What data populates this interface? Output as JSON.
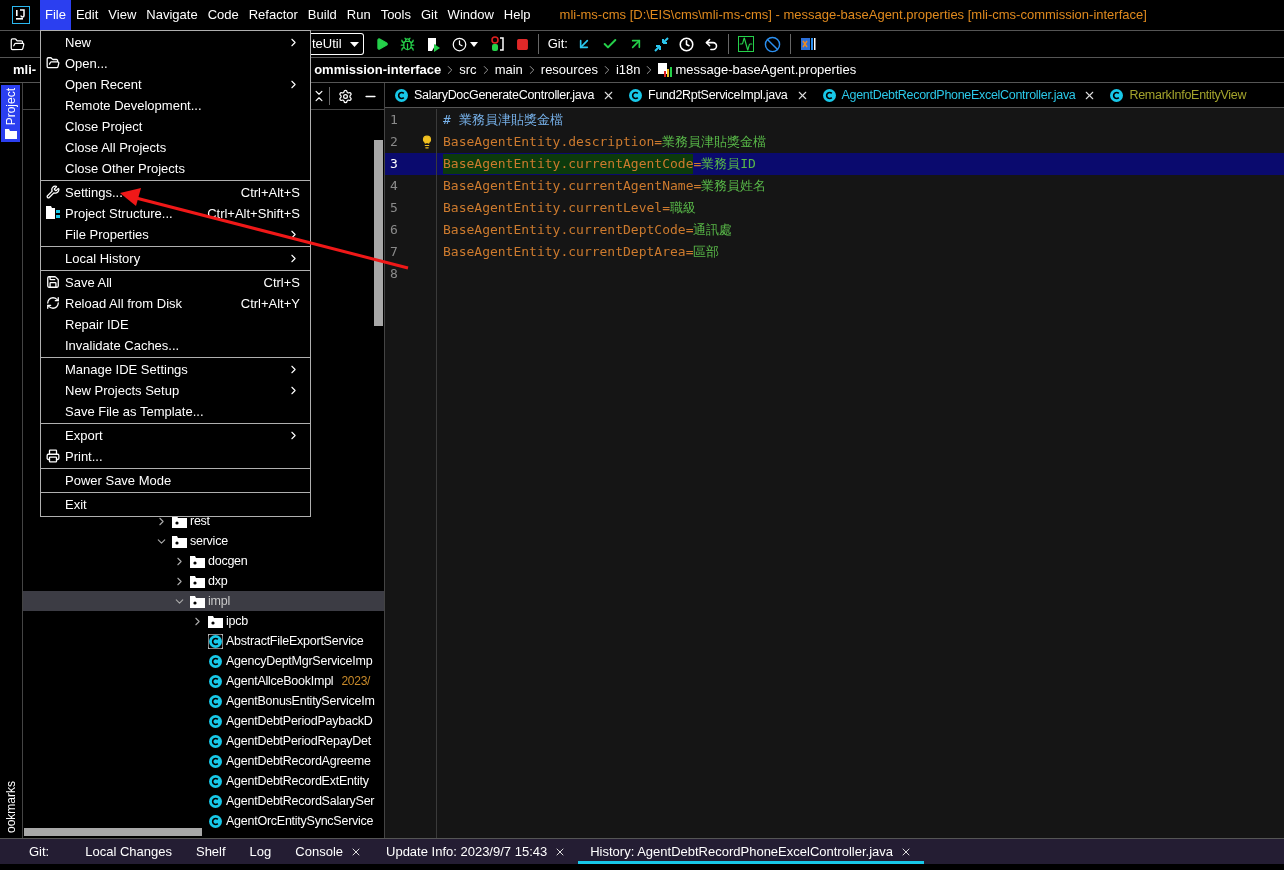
{
  "title_bar": {
    "menus": [
      {
        "label": "File",
        "selected": true
      },
      {
        "label": "Edit",
        "selected": false
      },
      {
        "label": "View",
        "selected": false
      },
      {
        "label": "Navigate",
        "selected": false
      },
      {
        "label": "Code",
        "selected": false
      },
      {
        "label": "Refactor",
        "selected": false
      },
      {
        "label": "Build",
        "selected": false
      },
      {
        "label": "Run",
        "selected": false
      },
      {
        "label": "Tools",
        "selected": false
      },
      {
        "label": "Git",
        "selected": false
      },
      {
        "label": "Window",
        "selected": false
      },
      {
        "label": "Help",
        "selected": false
      }
    ],
    "title": "mli-ms-cms [D:\\EIS\\cms\\mli-ms-cms] - message-baseAgent.properties [mli-cms-commission-interface]"
  },
  "toolbar": {
    "run_config": "teUtil",
    "git_label": "Git:"
  },
  "breadcrumb": {
    "project": "mli-",
    "items": [
      {
        "label": "ommission-interface",
        "kind": "module"
      },
      {
        "label": "src",
        "kind": "folder"
      },
      {
        "label": "main",
        "kind": "folder"
      },
      {
        "label": "resources",
        "kind": "folder"
      },
      {
        "label": "i18n",
        "kind": "folder"
      },
      {
        "label": "message-baseAgent.properties",
        "kind": "file"
      }
    ]
  },
  "side_tabs": [
    {
      "label": "Project",
      "selected": true
    },
    {
      "label": "ookmarks",
      "selected": false
    }
  ],
  "project_tree": [
    {
      "label": "rest",
      "kind": "folder",
      "expanded": false,
      "selected": false
    },
    {
      "label": "service",
      "kind": "folder",
      "expanded": true,
      "selected": false,
      "children": [
        {
          "label": "docgen",
          "kind": "folder",
          "expanded": false,
          "selected": false
        },
        {
          "label": "dxp",
          "kind": "folder",
          "expanded": false,
          "selected": false
        },
        {
          "label": "impl",
          "kind": "folder",
          "expanded": true,
          "selected": true,
          "children": [
            {
              "label": "ipcb",
              "kind": "folder",
              "expanded": false,
              "selected": false
            },
            {
              "label": "AbstractFileExportService",
              "kind": "abstract",
              "selected": false
            },
            {
              "label": "AgencyDeptMgrServiceImp",
              "kind": "class",
              "selected": false
            },
            {
              "label": "AgentAllceBookImpl",
              "kind": "class",
              "selected": false,
              "note": "2023/"
            },
            {
              "label": "AgentBonusEntityServiceIm",
              "kind": "class",
              "selected": false
            },
            {
              "label": "AgentDebtPeriodPaybackD",
              "kind": "class",
              "selected": false
            },
            {
              "label": "AgentDebtPeriodRepayDet",
              "kind": "class",
              "selected": false
            },
            {
              "label": "AgentDebtRecordAgreeme",
              "kind": "class",
              "selected": false
            },
            {
              "label": "AgentDebtRecordExtEntity",
              "kind": "class",
              "selected": false
            },
            {
              "label": "AgentDebtRecordSalarySer",
              "kind": "class",
              "selected": false
            },
            {
              "label": "AgentOrcEntitySyncService",
              "kind": "class",
              "selected": false
            }
          ]
        }
      ]
    }
  ],
  "editor": {
    "tabs": [
      {
        "label": "SalaryDocGenerateController.java",
        "color": "#ffffff",
        "closable": true
      },
      {
        "label": "Fund2RptServiceImpl.java",
        "color": "#ffffff",
        "closable": true
      },
      {
        "label": "AgentDebtRecordPhoneExcelController.java",
        "color": "#2bc8e8",
        "closable": true
      },
      {
        "label": "RemarkInfoEntityView",
        "color": "#a3a32c",
        "closable": false
      }
    ],
    "lines": [
      {
        "number": "1",
        "kind": "comment",
        "text": "# 業務員津貼獎金檔",
        "current": false
      },
      {
        "number": "2",
        "kind": "property",
        "key": "BaseAgentEntity.description",
        "separator": "=",
        "value": "業務員津貼獎金檔",
        "current": false,
        "highlighted": false,
        "bulb": true
      },
      {
        "number": "3",
        "kind": "property",
        "key": "BaseAgentEntity.currentAgentCode",
        "separator": "=",
        "value": "業務員ID",
        "current": true,
        "highlighted": true,
        "bulb": false
      },
      {
        "number": "4",
        "kind": "property",
        "key": "BaseAgentEntity.currentAgentName",
        "separator": "=",
        "value": "業務員姓名",
        "current": false,
        "highlighted": false,
        "bulb": false
      },
      {
        "number": "5",
        "kind": "property",
        "key": "BaseAgentEntity.currentLevel",
        "separator": "=",
        "value": "職級",
        "current": false,
        "highlighted": false,
        "bulb": false
      },
      {
        "number": "6",
        "kind": "property",
        "key": "BaseAgentEntity.currentDeptCode",
        "separator": "=",
        "value": "通訊處",
        "current": false,
        "highlighted": false,
        "bulb": false
      },
      {
        "number": "7",
        "kind": "property",
        "key": "BaseAgentEntity.currentDeptArea",
        "separator": "=",
        "value": "區部",
        "current": false,
        "highlighted": false,
        "bulb": false
      },
      {
        "number": "8",
        "kind": "empty",
        "current": false
      }
    ]
  },
  "file_menu": {
    "sections": [
      [
        {
          "label": "New",
          "submenu": true
        },
        {
          "label": "Open...",
          "kind": "open",
          "submenu": false
        },
        {
          "label": "Open Recent",
          "submenu": true
        },
        {
          "label": "Remote Development...",
          "submenu": false
        },
        {
          "label": "Close Project",
          "submenu": false
        },
        {
          "label": "Close All Projects",
          "submenu": false
        },
        {
          "label": "Close Other Projects",
          "submenu": false
        }
      ],
      [
        {
          "label": "Settings...",
          "kind": "wrench",
          "shortcut": "Ctrl+Alt+S",
          "submenu": false
        },
        {
          "label": "Project Structure...",
          "kind": "structure",
          "shortcut": "Ctrl+Alt+Shift+S",
          "submenu": false
        },
        {
          "label": "File Properties",
          "submenu": true
        }
      ],
      [
        {
          "label": "Local History",
          "submenu": true
        }
      ],
      [
        {
          "label": "Save All",
          "kind": "save",
          "shortcut": "Ctrl+S",
          "submenu": false
        },
        {
          "label": "Reload All from Disk",
          "kind": "reload",
          "shortcut": "Ctrl+Alt+Y",
          "submenu": false
        },
        {
          "label": "Repair IDE",
          "submenu": false
        },
        {
          "label": "Invalidate Caches...",
          "submenu": false
        }
      ],
      [
        {
          "label": "Manage IDE Settings",
          "submenu": true
        },
        {
          "label": "New Projects Setup",
          "submenu": true
        },
        {
          "label": "Save File as Template...",
          "submenu": false
        }
      ],
      [
        {
          "label": "Export",
          "submenu": true
        },
        {
          "label": "Print...",
          "kind": "print",
          "submenu": false
        }
      ],
      [
        {
          "label": "Power Save Mode",
          "submenu": false
        }
      ],
      [
        {
          "label": "Exit",
          "submenu": false
        }
      ]
    ]
  },
  "tool_windows": {
    "label": "Git:",
    "tabs": [
      {
        "label": "Local Changes",
        "closable": false,
        "selected": false
      },
      {
        "label": "Shelf",
        "closable": false,
        "selected": false
      },
      {
        "label": "Log",
        "closable": false,
        "selected": false
      },
      {
        "label": "Console",
        "closable": true,
        "selected": false
      },
      {
        "label": "Update Info: 2023/9/7 15:43",
        "closable": true,
        "selected": false
      },
      {
        "label": "History: AgentDebtRecordPhoneExcelController.java",
        "closable": true,
        "selected": true
      }
    ]
  }
}
